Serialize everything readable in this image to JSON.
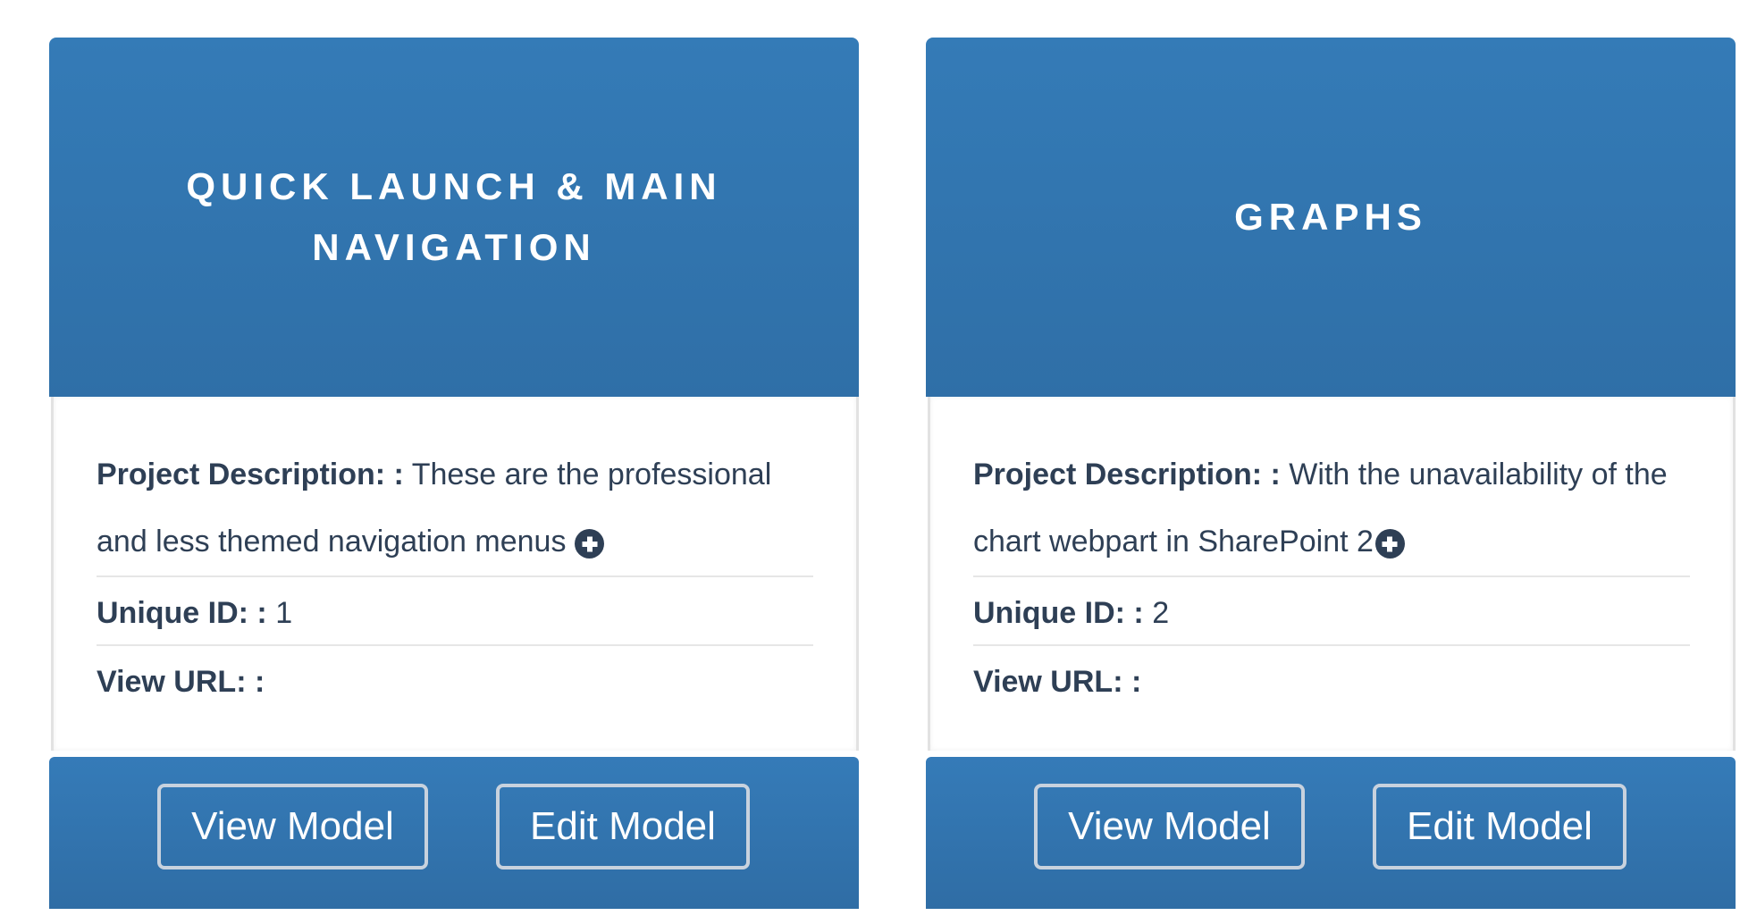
{
  "cards": [
    {
      "title": "Quick Launch & Main Navigation",
      "description_label": "Project Description: :",
      "description_value": "These are the professional and less themed navigation menus",
      "unique_id_label": "Unique ID: :",
      "unique_id_value": "1",
      "view_url_label": "View URL: :",
      "view_url_value": "",
      "view_button": "View Model",
      "edit_button": "Edit Model",
      "expand_icon": "plus-circle-icon"
    },
    {
      "title": "Graphs",
      "description_label": "Project Description: :",
      "description_value": "With the unavailability of the chart webpart in SharePoint 2",
      "unique_id_label": "Unique ID: :",
      "unique_id_value": "2",
      "view_url_label": "View URL: :",
      "view_url_value": "",
      "view_button": "View Model",
      "edit_button": "Edit Model",
      "expand_icon": "plus-circle-icon"
    }
  ],
  "colors": {
    "header_blue": "#347bb7",
    "text_dark": "#2e3f55",
    "button_border": "#c8d2de"
  }
}
